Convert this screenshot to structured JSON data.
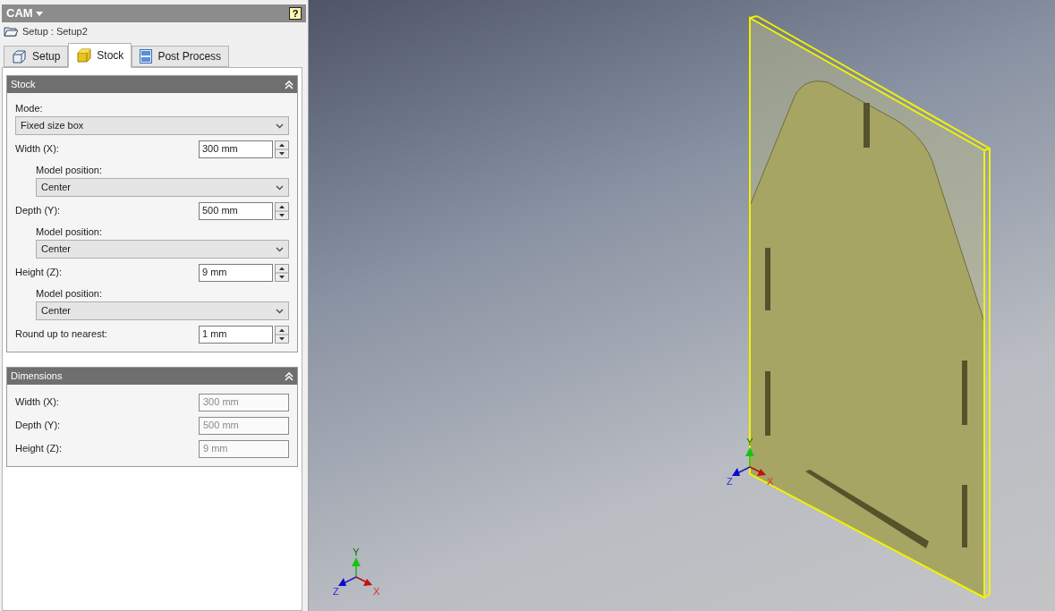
{
  "panel": {
    "title": "CAM",
    "help": "?",
    "breadcrumb": "Setup : Setup2",
    "tabs": [
      {
        "label": "Setup",
        "selected": false
      },
      {
        "label": "Stock",
        "selected": true
      },
      {
        "label": "Post Process",
        "selected": false
      }
    ],
    "sections": [
      {
        "title": "Stock",
        "expanded": true,
        "rows": [
          {
            "kind": "select",
            "label": "Mode:",
            "value": "Fixed size box"
          },
          {
            "kind": "spinner",
            "label": "Width (X):",
            "value": "300 mm"
          },
          {
            "kind": "subselect",
            "label": "Model position:",
            "value": "Center"
          },
          {
            "kind": "spinner",
            "label": "Depth (Y):",
            "value": "500 mm"
          },
          {
            "kind": "subselect",
            "label": "Model position:",
            "value": "Center"
          },
          {
            "kind": "spinner",
            "label": "Height (Z):",
            "value": "9 mm"
          },
          {
            "kind": "subselect",
            "label": "Model position:",
            "value": "Center"
          },
          {
            "kind": "spinner",
            "label": "Round up to nearest:",
            "value": "1 mm"
          }
        ]
      },
      {
        "title": "Dimensions",
        "expanded": true,
        "rows": [
          {
            "kind": "readonly",
            "label": "Width (X):",
            "value": "300 mm"
          },
          {
            "kind": "readonly",
            "label": "Depth (Y):",
            "value": "500 mm"
          },
          {
            "kind": "readonly",
            "label": "Height (Z):",
            "value": "9 mm"
          }
        ]
      }
    ]
  },
  "viewport": {
    "model_triad": {
      "y": "Y",
      "z": "Z",
      "x": "X"
    },
    "corner_triad": {
      "y": "Y",
      "z": "Z",
      "x": "X"
    }
  }
}
